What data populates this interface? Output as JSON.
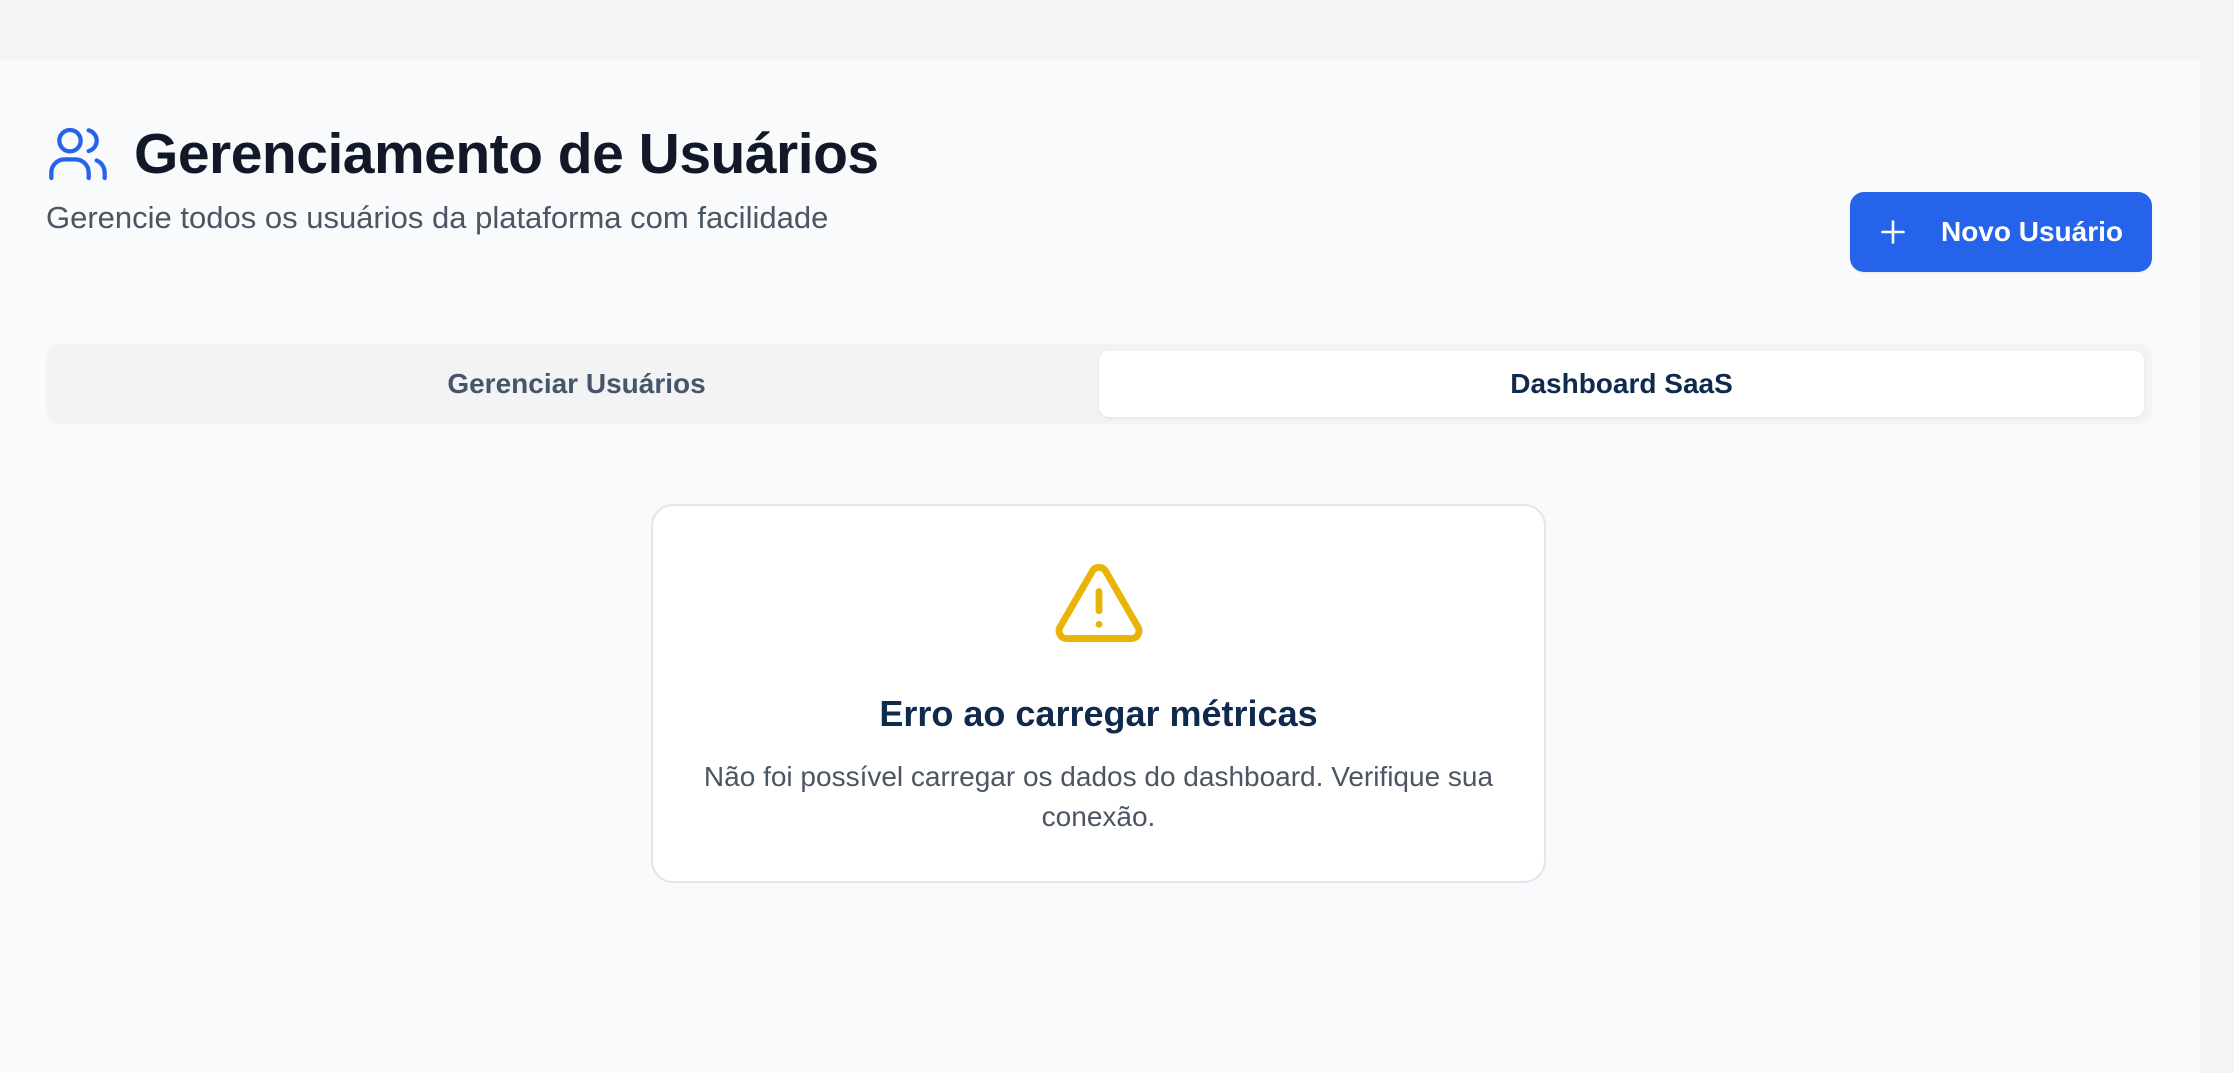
{
  "header": {
    "title": "Gerenciamento de Usuários",
    "subtitle": "Gerencie todos os usuários da plataforma com facilidade",
    "icon": "users-icon"
  },
  "actions": {
    "new_user_label": "Novo Usuário",
    "new_user_icon": "plus-icon"
  },
  "tabs": [
    {
      "label": "Gerenciar Usuários",
      "active": false
    },
    {
      "label": "Dashboard SaaS",
      "active": true
    }
  ],
  "error": {
    "icon": "warning-icon",
    "title": "Erro ao carregar métricas",
    "message": "Não foi possível carregar os dados do dashboard. Verifique sua conexão."
  },
  "colors": {
    "accent": "#2563eb",
    "warning": "#eab308",
    "heading": "#0f2a4d",
    "background": "#f8fafc"
  }
}
